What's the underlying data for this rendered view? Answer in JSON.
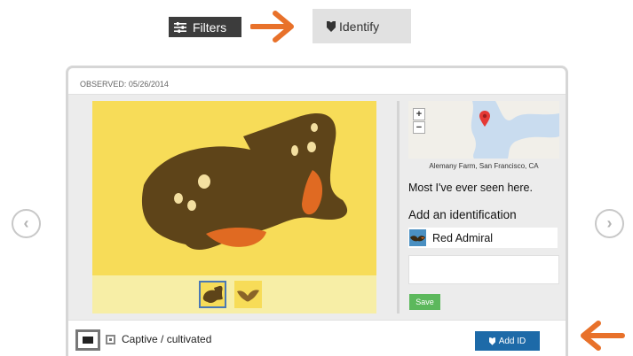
{
  "toolbar": {
    "filters_label": "Filters",
    "identify_label": "Identify"
  },
  "observation": {
    "observed_label": "OBSERVED: 05/26/2014"
  },
  "navigation": {
    "prev_glyph": "‹",
    "next_glyph": "›"
  },
  "map": {
    "zoom_in": "+",
    "zoom_out": "−",
    "location": "Alemany Farm, San Francisco, CA"
  },
  "description": "Most I've ever seen here.",
  "identification": {
    "heading": "Add an identification",
    "taxon_name": "Red Admiral",
    "save_label": "Save"
  },
  "footer": {
    "captive_label": "Captive / cultivated",
    "add_id_label": "Add ID"
  },
  "colors": {
    "accent_orange": "#e8712a",
    "photo_bg": "#f7dc58",
    "wing_brown": "#5e4419",
    "save_green": "#5cb85c",
    "add_id_blue": "#1d6aa8"
  },
  "icons": {
    "filters": "sliders-icon",
    "identify": "shield-icon",
    "map_marker": "map-marker-icon"
  }
}
